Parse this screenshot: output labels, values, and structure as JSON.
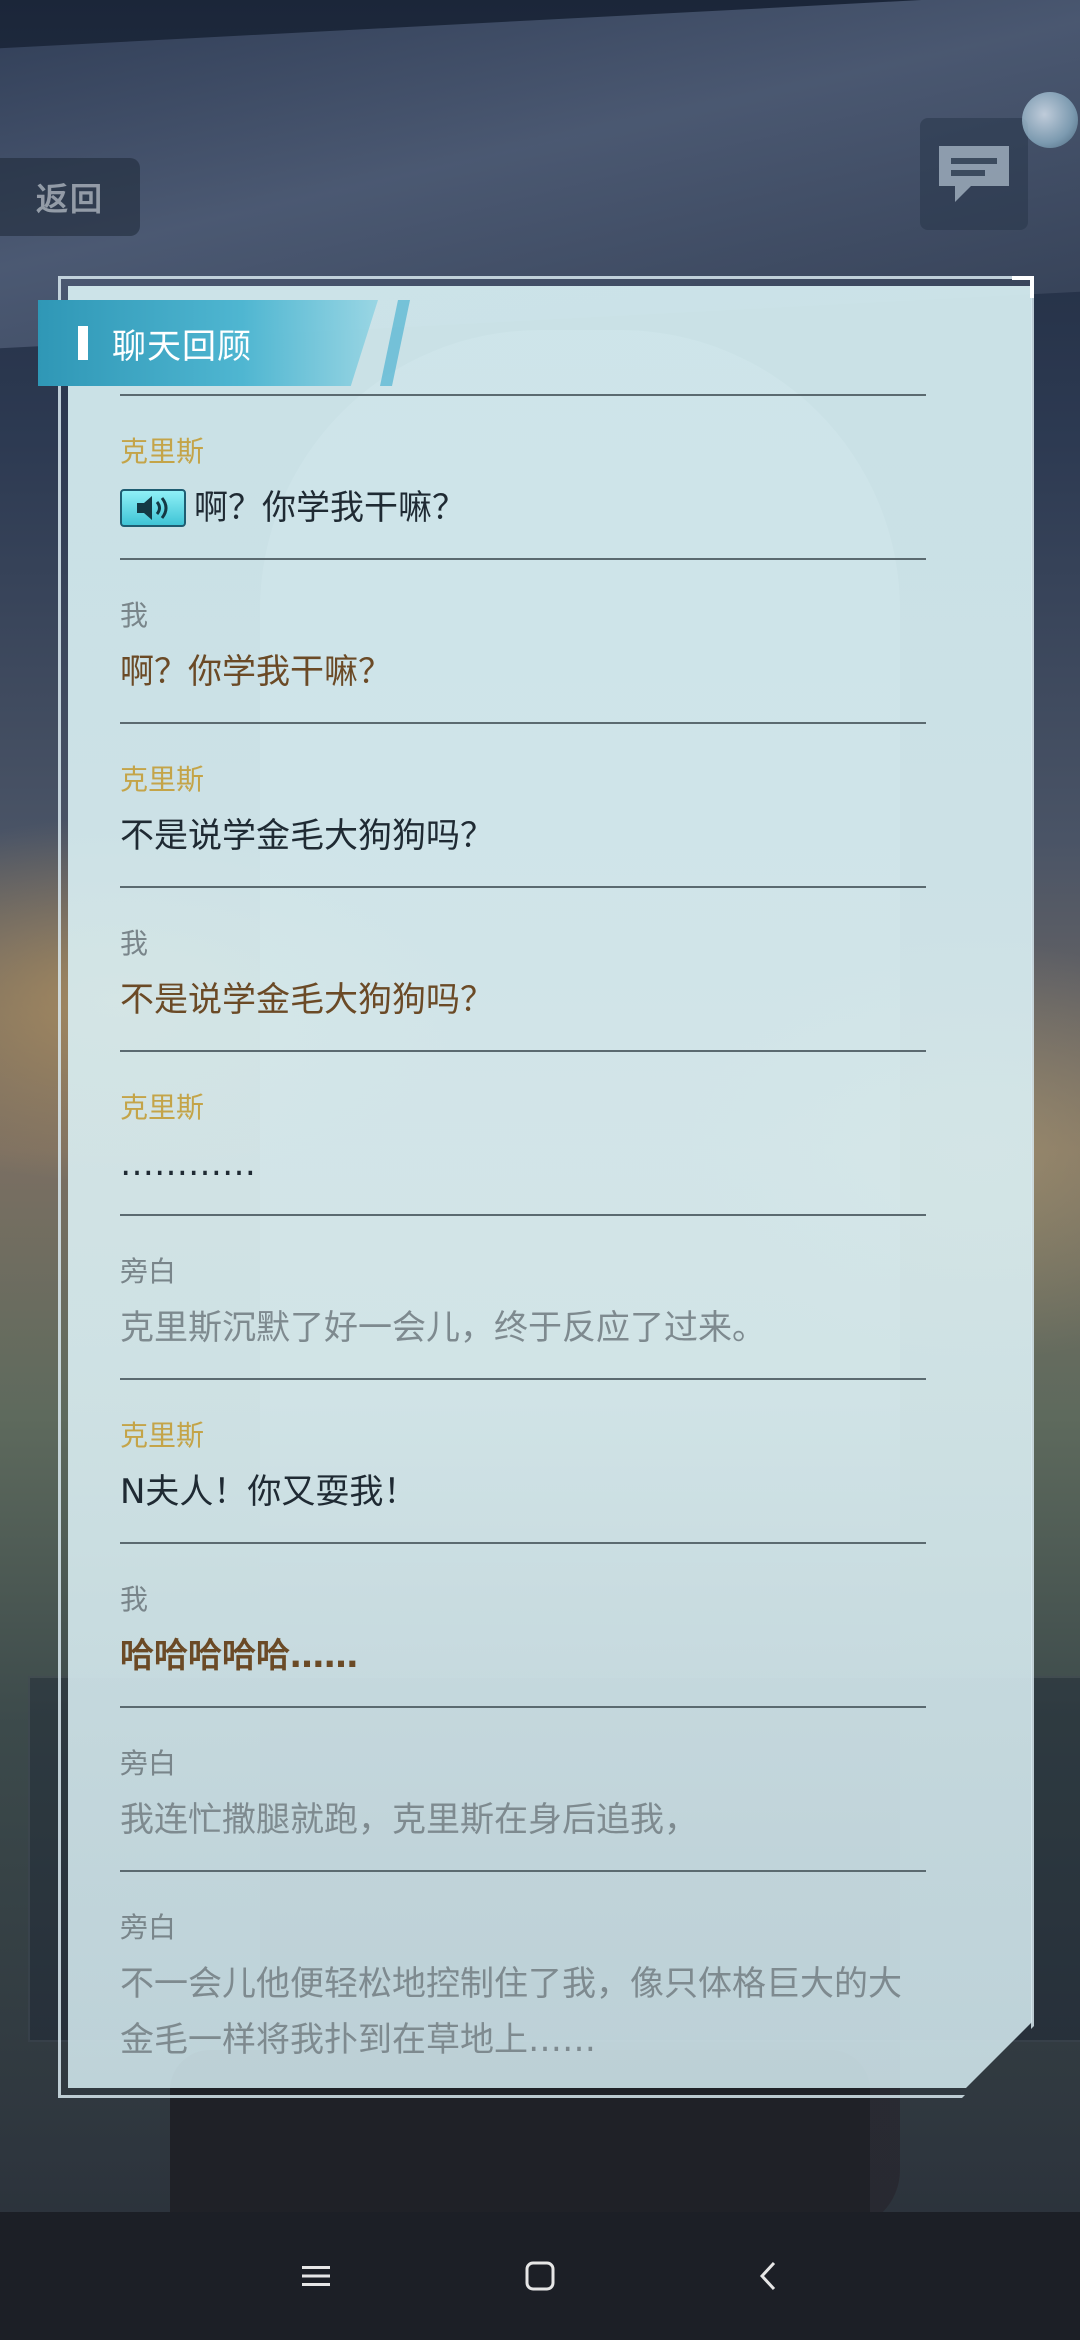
{
  "top": {
    "back_label": "返回"
  },
  "panel": {
    "title": "聊天回顾"
  },
  "entries": [
    {
      "speaker": "克里斯",
      "text": "啊？你学我干嘛？"
    },
    {
      "speaker": "我",
      "text": "啊？你学我干嘛？"
    },
    {
      "speaker": "克里斯",
      "text": "不是说学金毛大狗狗吗？"
    },
    {
      "speaker": "我",
      "text": "不是说学金毛大狗狗吗？"
    },
    {
      "speaker": "克里斯",
      "text": "…………"
    },
    {
      "speaker": "旁白",
      "text": "克里斯沉默了好一会儿，终于反应了过来。"
    },
    {
      "speaker": "克里斯",
      "text": "N夫人！你又耍我！"
    },
    {
      "speaker": "我",
      "text": "哈哈哈哈哈……"
    },
    {
      "speaker": "旁白",
      "text": "我连忙撒腿就跑，克里斯在身后追我，"
    },
    {
      "speaker": "旁白",
      "text": "不一会儿他便轻松地控制住了我，像只体格巨大的大金毛一样将我扑到在草地上……"
    }
  ],
  "icons": {
    "voice": "speaker-icon",
    "chat": "chat-bubble-icon",
    "nav": [
      "menu-icon",
      "home-icon",
      "back-icon"
    ]
  },
  "colors": {
    "speaker_npc": "#c4a448",
    "speaker_me": "#79858a",
    "text_npc": "#1f2a33",
    "text_me": "#6b4a26",
    "text_narration": "#7e8a8f",
    "tab": "#3aa7c4"
  }
}
